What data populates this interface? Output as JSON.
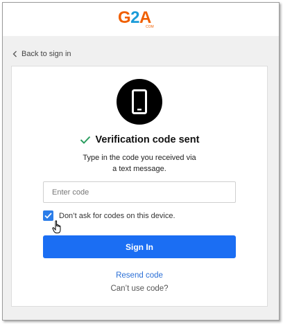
{
  "header": {
    "logo_main": "G",
    "logo_two": "2",
    "logo_tail": "A",
    "logo_com": "COM"
  },
  "nav": {
    "back_label": "Back to sign in"
  },
  "verification": {
    "title": "Verification code sent",
    "description_line1": "Type in the code you received via",
    "description_line2": "a text message."
  },
  "form": {
    "code_placeholder": "Enter code",
    "code_value": "",
    "remember_label": "Don’t ask for codes on this device.",
    "remember_checked": true,
    "signin_label": "Sign In",
    "resend_label": "Resend code",
    "cant_use_label": "Can’t use code?"
  },
  "colors": {
    "primary": "#1b6ef3",
    "link": "#2b6fd6",
    "success_check": "#2a9d5f",
    "logo_orange": "#f05f00",
    "logo_blue": "#1a9bd8"
  }
}
